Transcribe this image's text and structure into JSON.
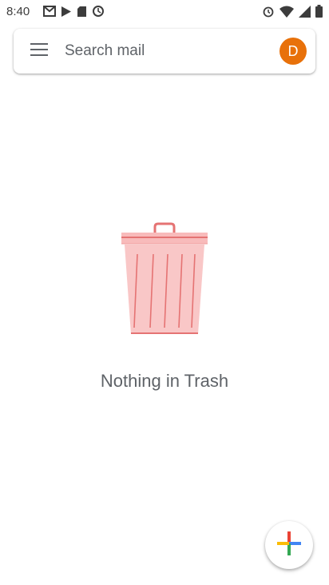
{
  "status_bar": {
    "time": "8:40",
    "left_icons": [
      "gmail-notification-icon",
      "play-store-icon",
      "sd-card-icon",
      "sync-icon"
    ],
    "right_icons": [
      "alarm-icon",
      "wifi-icon",
      "signal-icon",
      "battery-icon"
    ]
  },
  "search": {
    "placeholder": "Search mail",
    "menu_icon": "hamburger-menu-icon"
  },
  "account": {
    "avatar_letter": "D",
    "avatar_color": "#e8710a"
  },
  "empty_state": {
    "illustration": "trash-can-icon",
    "message": "Nothing in Trash",
    "accent_color": "#ef9a9a",
    "lid_color": "#e57373"
  },
  "compose": {
    "icon": "plus-icon",
    "colors": [
      "#4285f4",
      "#ea4335",
      "#fbbc05",
      "#34a853"
    ]
  }
}
